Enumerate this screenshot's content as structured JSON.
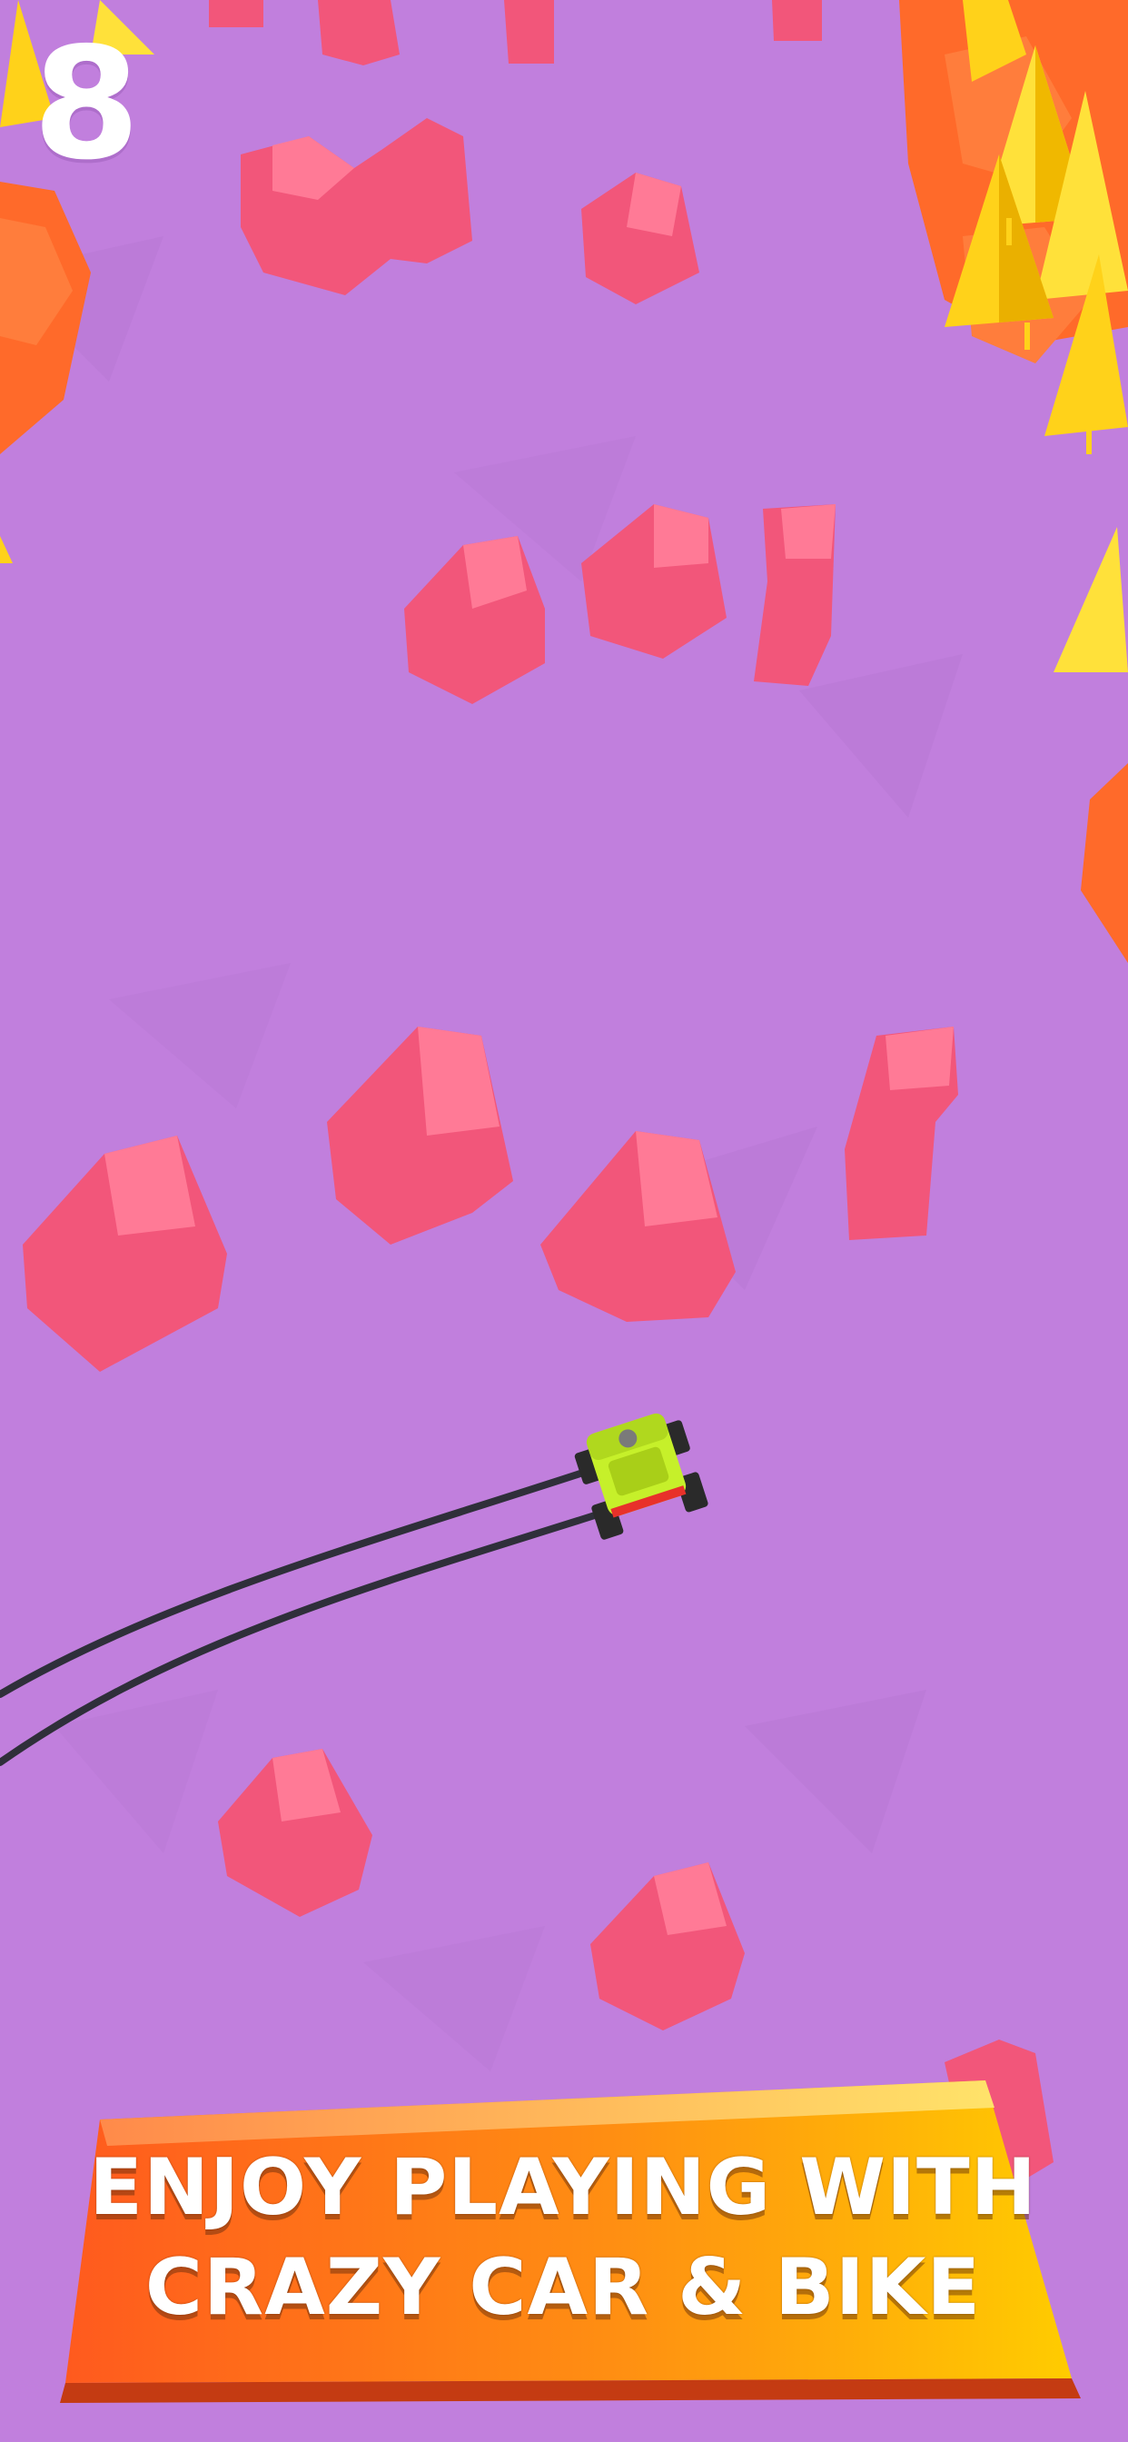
{
  "hud": {
    "score": "8"
  },
  "promo": {
    "line1": "ENJOY PLAYING WITH",
    "line2": "CRAZY CAR & BIKE"
  },
  "colors": {
    "ground": "#c17fdd",
    "rock": "#f2567a",
    "tree": "#ffd21a",
    "bush": "#ff6a2a",
    "car": "#c6f02a",
    "banner_left": "#ff5a1e",
    "banner_right": "#ffcc00"
  }
}
